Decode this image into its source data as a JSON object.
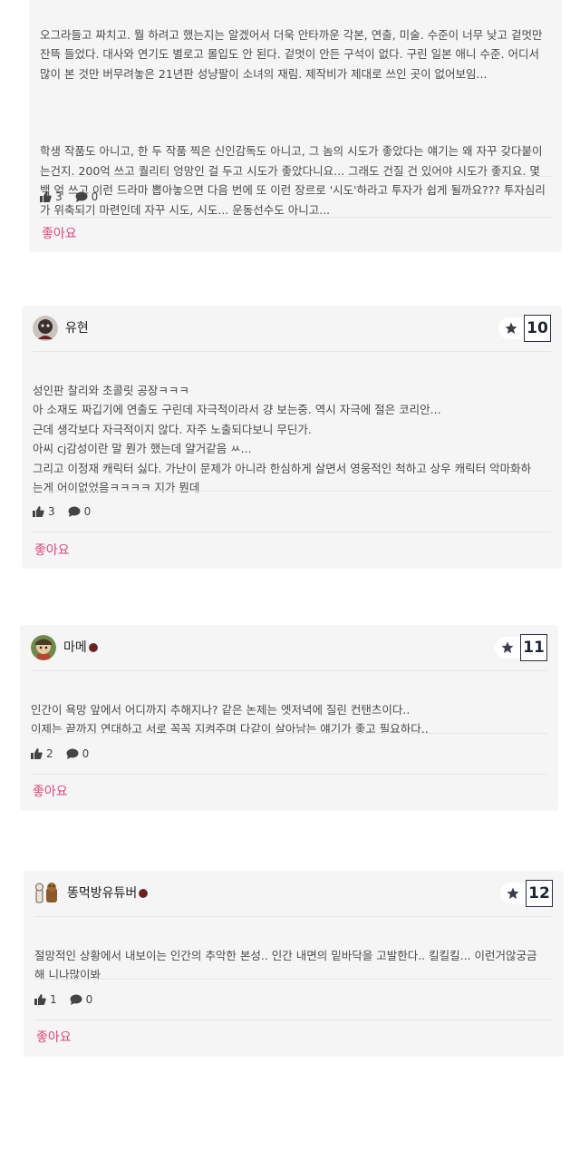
{
  "reviews": [
    {
      "paragraphs": [
        "오그라들고 짜치고. 뭘 하려고 했는지는 알겠어서 더욱 안타까운 각본, 연출, 미술. 수준이 너무 낮고 겉멋만\n잔뜩 들었다. 대사와 연기도 별로고 몰입도 안 된다. 겉멋이 안든 구석이 없다. 구린 일본 애니 수준. 어디서\n많이 본 것만 버무려놓은 21년판 성냥팔이 소녀의 재림. 제작비가 제대로 쓰인 곳이 없어보임...",
        "학생 작품도 아니고, 한 두 작품 찍은 신인감독도 아니고, 그 놈의 시도가 좋았다는 얘기는 왜 자꾸 갖다붙이\n는건지. 200억 쓰고 퀄리티 엉망인 걸 두고 시도가 좋았다니요... 그래도 건질 건 있어야 시도가 좋지요. 몇\n백 억 쓰고 이런 드라마 뽑아놓으면 다음 번에 또 이런 장르로 '시도'하라고 투자가 쉽게 될까요??? 투자심리\n가 위축되기 마련인데 자꾸 시도, 시도... 운동선수도 아니고..."
      ],
      "likes": "3",
      "comments": "0",
      "like_label": "좋아요"
    },
    {
      "username": "유현",
      "rank": "10",
      "paragraphs": [
        "성인판 찰리와 초콜릿 공장ㅋㅋㅋ\n아 소재도 짜깁기에 연출도 구린데 자극적이라서 걍 보는중. 역시 자극에 절은 코리안...\n근데 생각보다 자극적이지 않다. 자주 노출되다보니 무딘가.\n아씨 cj감성이란 말 뭔가 했는데 얄거같음 ㅆ...\n그리고 이정재 캐릭터 싫다. 가난이 문제가 아니라 한심하게 살면서 영웅적인 척하고 상우 캐릭터 악마화하\n는게 어이없었음ㅋㅋㅋㅋ 지가 뭔데"
      ],
      "likes": "3",
      "comments": "0",
      "like_label": "좋아요"
    },
    {
      "username": "마메",
      "rank": "11",
      "paragraphs": [
        "인간이 욕망 앞에서 어디까지 추해지나? 같은 논제는 엣저녁에 질린 컨탠츠이다..\n이제는 끝까지 연대하고 서로 꼭꼭 지켜주며 다같이 살아남는 얘기가 좋고 필요하다.."
      ],
      "likes": "2",
      "comments": "0",
      "like_label": "좋아요"
    },
    {
      "username": "똥먹방유튜버",
      "rank": "12",
      "paragraphs": [
        "절망적인 상황에서 내보이는 인간의 추악한 본성.. 인간 내면의 밑바닥을 고발한다.. 킬킬킬... 이런거않궁금\n해 니나많이봐"
      ],
      "likes": "1",
      "comments": "0",
      "like_label": "좋아요"
    }
  ]
}
